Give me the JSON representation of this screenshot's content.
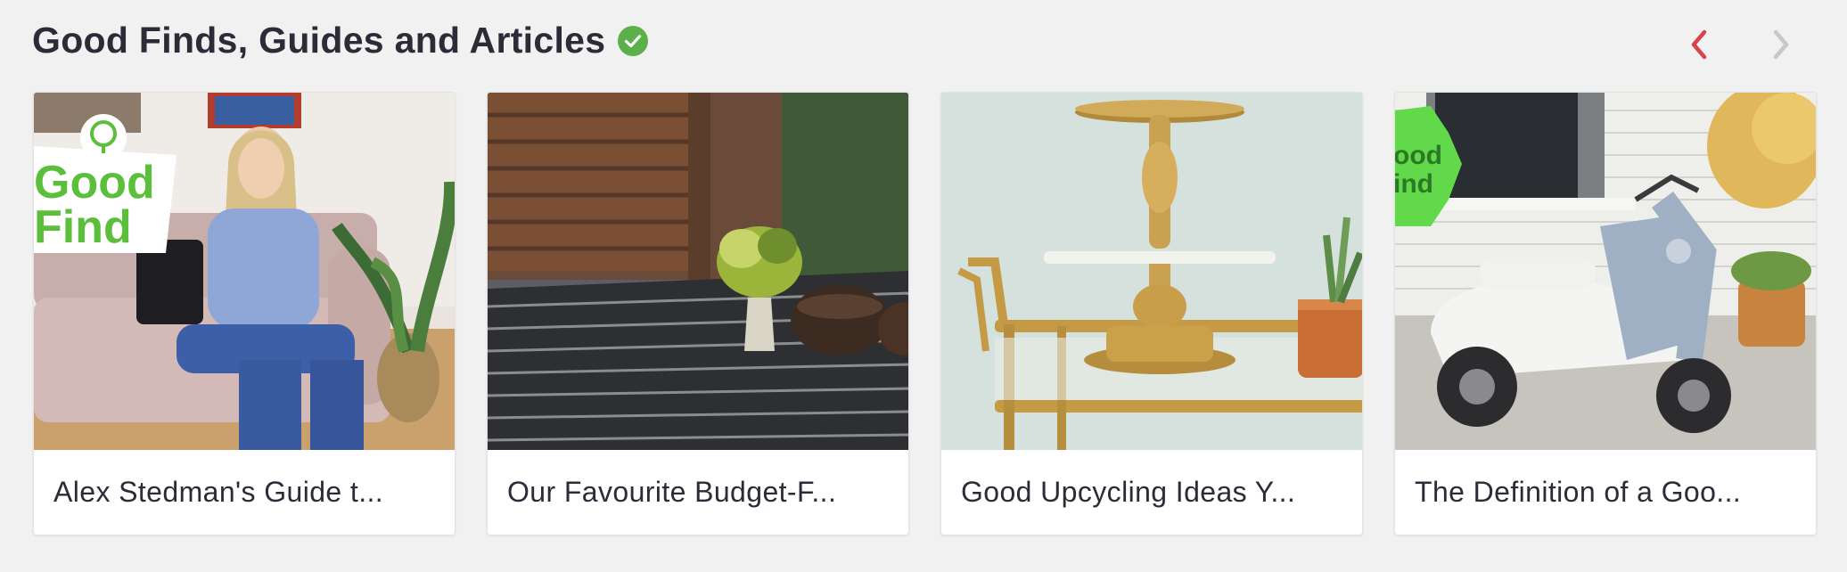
{
  "section": {
    "title": "Good Finds, Guides and Articles",
    "verified_icon": "check-circle-icon",
    "colors": {
      "verified": "#5bb04a",
      "prev_arrow": "#d9434e",
      "next_arrow": "#c8c8c8"
    }
  },
  "navigation": {
    "prev_icon": "chevron-left-icon",
    "next_icon": "chevron-right-icon"
  },
  "cards": [
    {
      "title": "Alex Stedman's Guide t...",
      "badge": "Good Find"
    },
    {
      "title": "Our Favourite Budget-F..."
    },
    {
      "title": "Good Upcycling Ideas Y..."
    },
    {
      "title": "The Definition of a Goo...",
      "badge": "Good Find"
    }
  ]
}
